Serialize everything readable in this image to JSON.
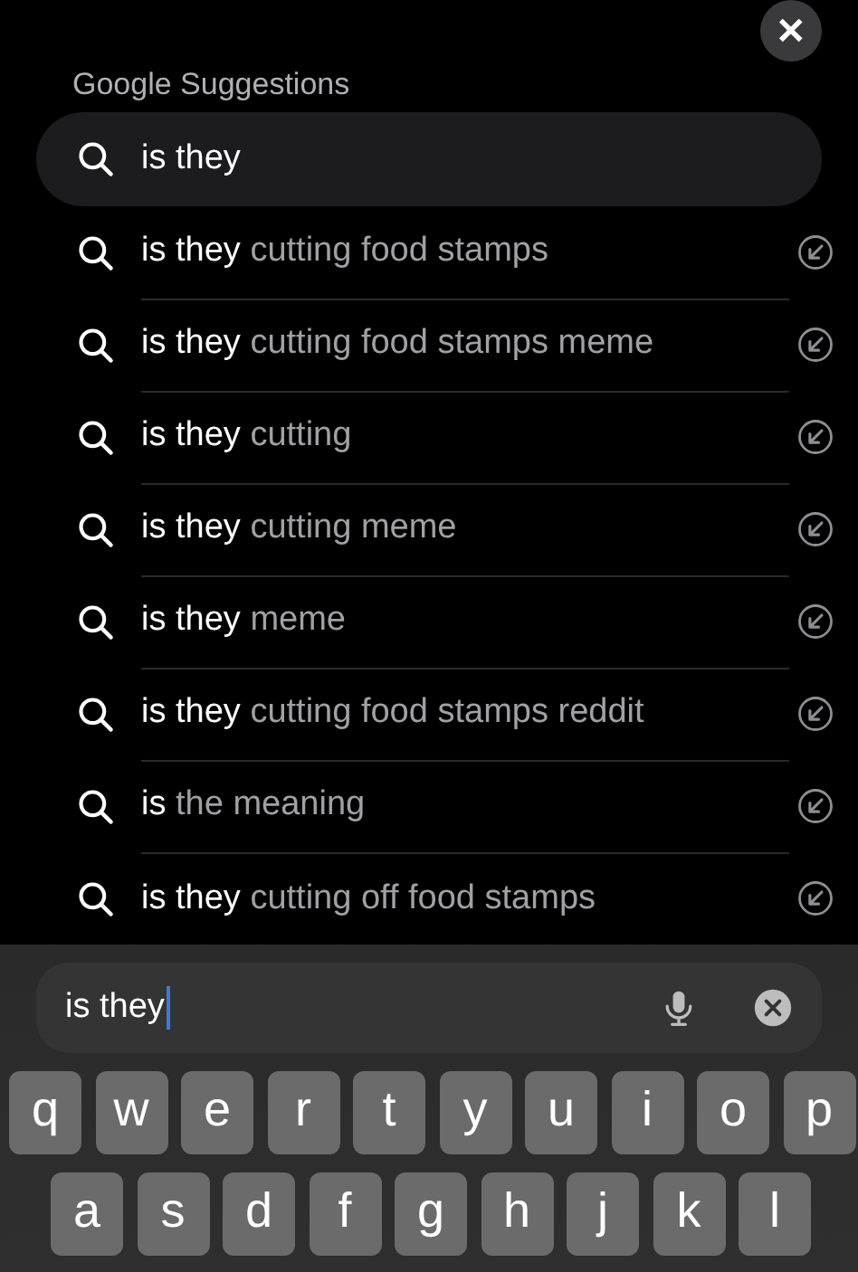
{
  "close_button": {
    "label": "✕"
  },
  "header": "Google Suggestions",
  "suggestions": [
    {
      "kind": "query",
      "typed": "is they"
    },
    {
      "kind": "suggestion",
      "typed": "is they",
      "completion": "cutting food stamps"
    },
    {
      "kind": "suggestion",
      "typed": "is they",
      "completion": "cutting food stamps meme"
    },
    {
      "kind": "suggestion",
      "typed": "is they",
      "completion": "cutting"
    },
    {
      "kind": "suggestion",
      "typed": "is they",
      "completion": "cutting meme"
    },
    {
      "kind": "suggestion",
      "typed": "is they",
      "completion": "meme"
    },
    {
      "kind": "suggestion",
      "typed": "is they",
      "completion": "cutting food stamps reddit"
    },
    {
      "kind": "suggestion",
      "typed": "is",
      "completion": "the meaning"
    },
    {
      "kind": "suggestion",
      "typed": "is they",
      "completion": "cutting off food stamps"
    }
  ],
  "search_field": {
    "value": "is they"
  },
  "keyboard": [
    [
      "q",
      "w",
      "e",
      "r",
      "t",
      "y",
      "u",
      "i",
      "o",
      "p"
    ],
    [
      "a",
      "s",
      "d",
      "f",
      "g",
      "h",
      "j",
      "k",
      "l"
    ]
  ]
}
